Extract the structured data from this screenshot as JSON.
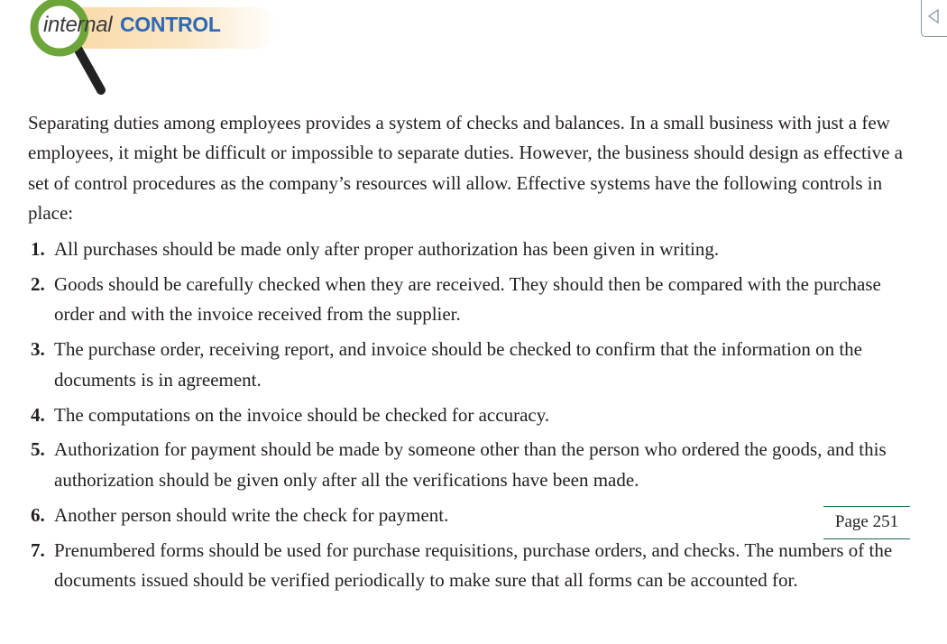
{
  "header": {
    "badge_word_1": "internal",
    "badge_word_2": "CONTROL",
    "magnifier_icon": "magnifying-glass-icon"
  },
  "intro": "Separating duties among employees provides a system of checks and balances. In a small business with just a few employees, it might be difficult or impossible to separate duties. However, the business should design as effective a set of control procedures as the company’s resources will allow. Effective systems have the following controls in place:",
  "controls": [
    {
      "num": "1.",
      "text": "All purchases should be made only after proper authorization has been given in writing."
    },
    {
      "num": "2.",
      "text": "Goods should be carefully checked when they are received. They should then be compared with the purchase order and with the invoice received from the supplier."
    },
    {
      "num": "3.",
      "text": "The purchase order, receiving report, and invoice should be checked to confirm that the information on the documents is in agreement."
    },
    {
      "num": "4.",
      "text": "The computations on the invoice should be checked for accuracy."
    },
    {
      "num": "5.",
      "text": "Authorization for payment should be made by someone other than the person who ordered the goods, and this authorization should be given only after all the verifications have been made."
    },
    {
      "num": "6.",
      "text": "Another person should write the check for payment."
    },
    {
      "num": "7.",
      "text": "Prenumbered forms should be used for purchase requisitions, purchase orders, and checks. The numbers of the documents issued should be verified periodically to make sure that all forms can be accounted for."
    }
  ],
  "page_marker": "Page 251",
  "corner_control_icon": "collapse-arrow-icon",
  "colors": {
    "badge_ring": "#6da53a",
    "badge_band": "#f9d9a6",
    "control_word": "#2f68b3",
    "page_rule": "#1e6b45"
  }
}
